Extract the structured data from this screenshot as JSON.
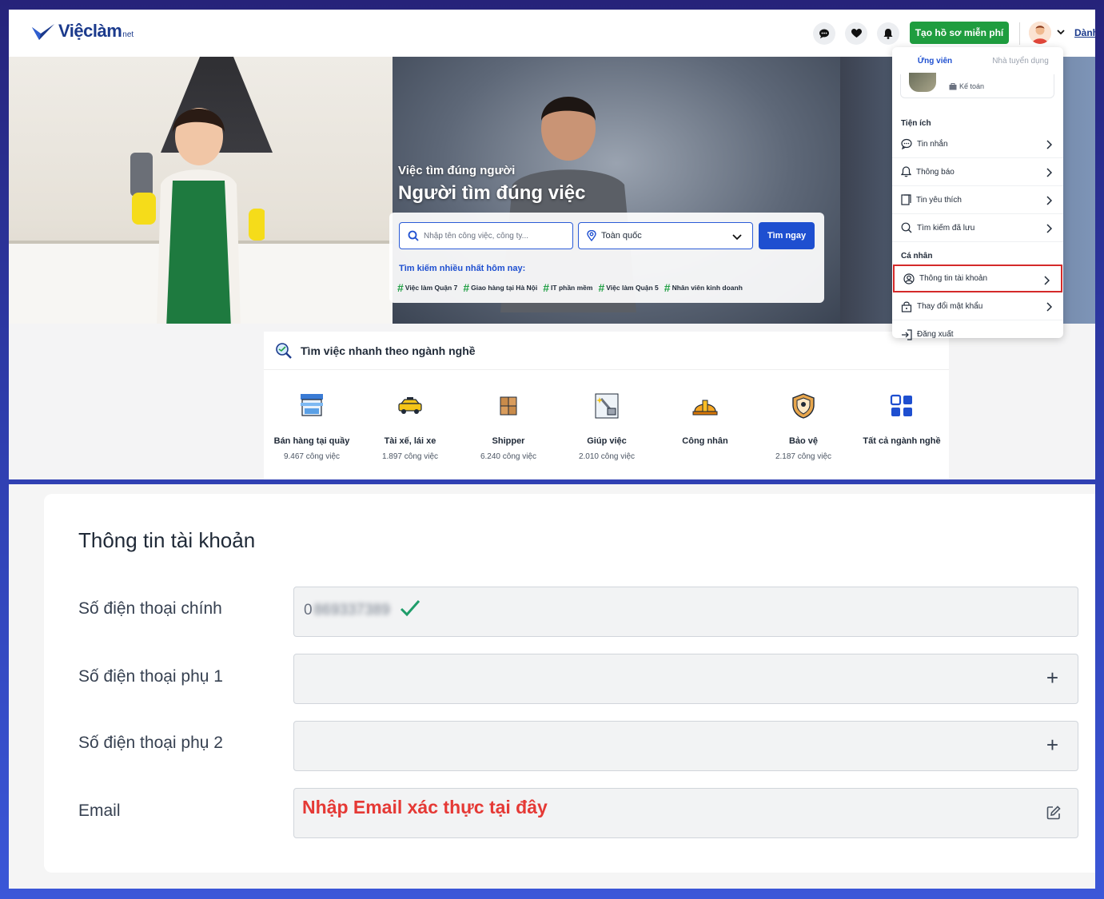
{
  "header": {
    "logo_text": "Việclàm",
    "logo_suffix": "net",
    "cv_button": "Tạo hồ sơ miễn phí",
    "danh_link": "Dành"
  },
  "hero": {
    "subtitle": "Việc tìm đúng người",
    "title": "Người tìm đúng việc",
    "search_placeholder": "Nhập tên công việc, công ty...",
    "location_value": "Toàn quốc",
    "search_button": "Tìm ngay",
    "trending_title": "Tìm kiếm nhiều nhất hôm nay:",
    "trending": [
      "Việc làm Quận 7",
      "Giao hàng tại Hà Nội",
      "IT phần mềm",
      "Việc làm Quận 5",
      "Nhân viên kinh doanh"
    ]
  },
  "quick_jobs": {
    "title": "Tìm việc nhanh theo ngành nghề",
    "categories": [
      {
        "name": "Bán hàng tại quầy",
        "count": "9.467 công việc",
        "icon": "shop-icon"
      },
      {
        "name": "Tài xế, lái xe",
        "count": "1.897 công việc",
        "icon": "taxi-icon"
      },
      {
        "name": "Shipper",
        "count": "6.240 công việc",
        "icon": "boxes-icon"
      },
      {
        "name": "Giúp việc",
        "count": "2.010 công việc",
        "icon": "cleaning-icon"
      },
      {
        "name": "Công nhân",
        "count": "",
        "icon": "hardhat-icon"
      },
      {
        "name": "Bảo vệ",
        "count": "2.187 công việc",
        "icon": "shield-icon"
      },
      {
        "name": "Tất cả ngành nghề",
        "count": "",
        "icon": "grid-icon"
      }
    ]
  },
  "menu": {
    "tab_candidate": "Ứng viên",
    "tab_employer": "Nhà tuyển dụng",
    "profile_job": "Kế toán",
    "section_utilities": "Tiện ích",
    "section_personal": "Cá nhân",
    "items": {
      "messages": "Tin nhắn",
      "notifications": "Thông báo",
      "favorites": "Tin yêu thích",
      "saved_searches": "Tìm kiếm đã lưu",
      "account_info": "Thông tin tài khoản",
      "change_password": "Thay đổi mật khẩu",
      "logout": "Đăng xuất"
    }
  },
  "account": {
    "title": "Thông tin tài khoản",
    "primary_phone_label": "Số điện thoại chính",
    "primary_phone_prefix": "0",
    "primary_phone_masked": "869337389",
    "secondary_phone_1_label": "Số điện thoại phụ 1",
    "secondary_phone_2_label": "Số điện thoại phụ 2",
    "email_label": "Email",
    "email_placeholder": "Nhập Email xác thực tại đây",
    "plus_symbol": "+"
  },
  "colors": {
    "brand_blue": "#1e4fd0",
    "green": "#1f9d3f",
    "highlight_red": "#d42a2a",
    "email_red": "#e53935"
  }
}
